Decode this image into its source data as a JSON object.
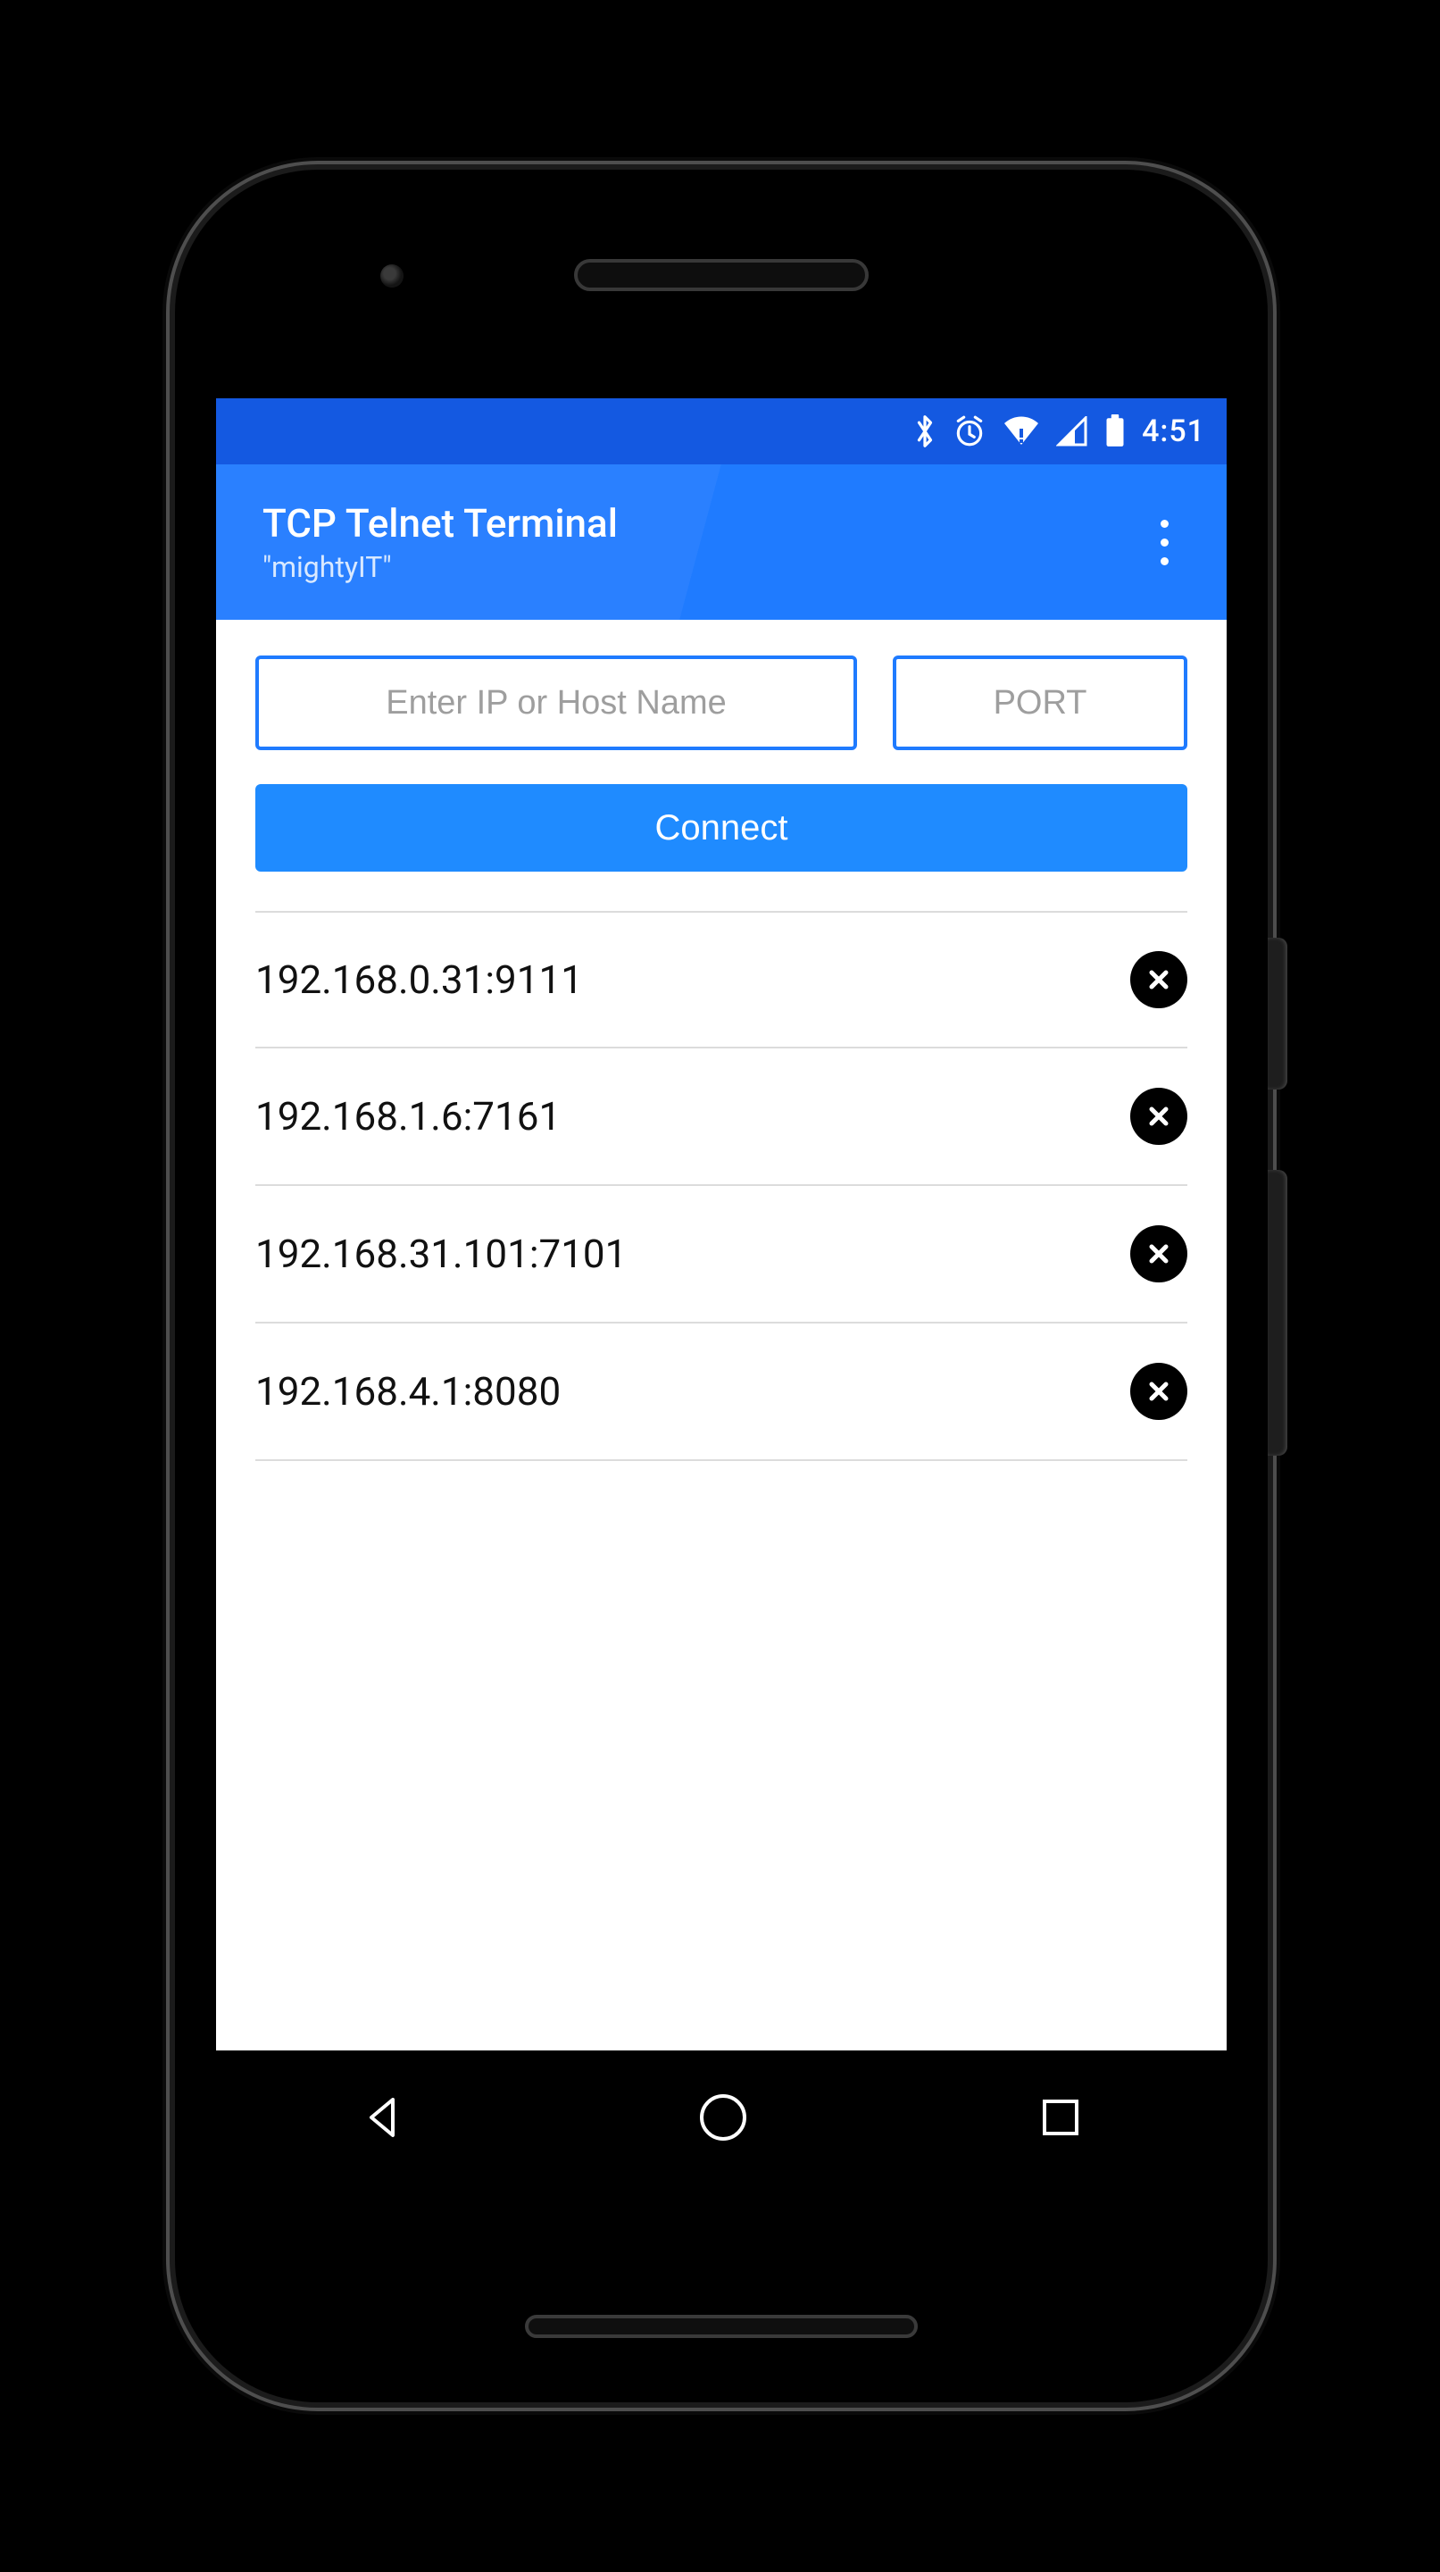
{
  "status": {
    "time": "4:51"
  },
  "appbar": {
    "title": "TCP Telnet Terminal",
    "subtitle": "\"mightyIT\""
  },
  "inputs": {
    "ip_placeholder": "Enter IP or Host Name",
    "ip_value": "",
    "port_placeholder": "PORT",
    "port_value": ""
  },
  "connect_label": "Connect",
  "history": [
    {
      "address": "192.168.0.31:9111"
    },
    {
      "address": "192.168.1.6:7161"
    },
    {
      "address": "192.168.31.101:7101"
    },
    {
      "address": "192.168.4.1:8080"
    }
  ]
}
